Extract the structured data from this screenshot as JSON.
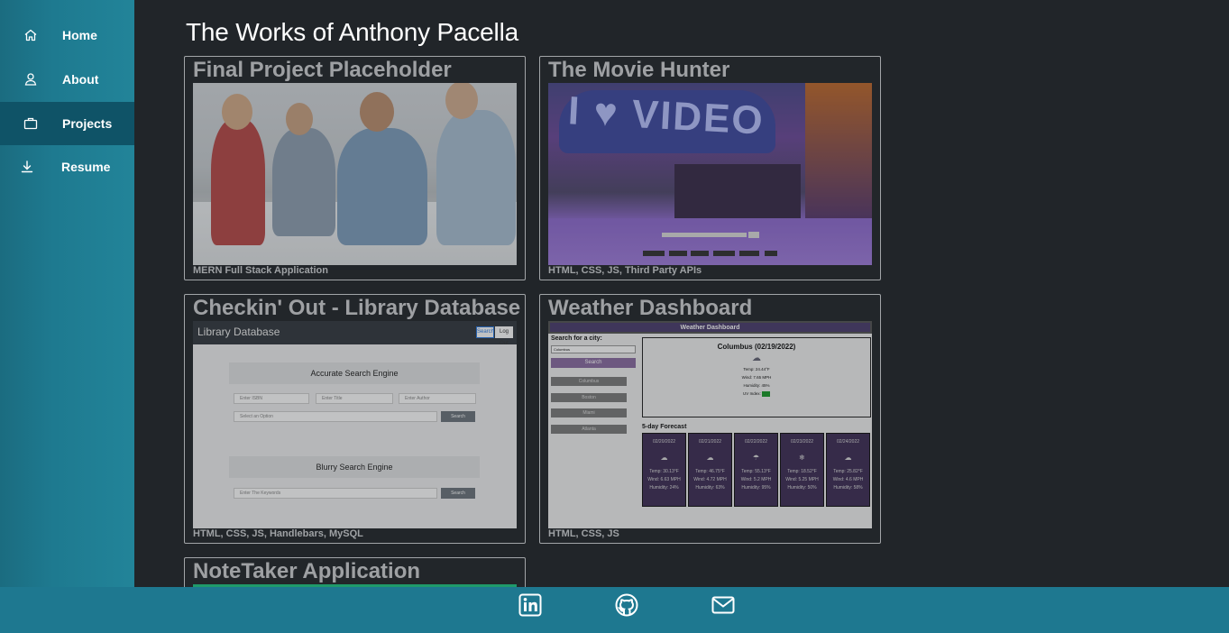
{
  "sidebar": {
    "items": [
      {
        "label": "Home",
        "icon": "home-icon"
      },
      {
        "label": "About",
        "icon": "user-icon"
      },
      {
        "label": "Projects",
        "icon": "briefcase-icon",
        "active": true
      },
      {
        "label": "Resume",
        "icon": "download-icon"
      }
    ]
  },
  "page": {
    "title": "The Works of Anthony Pacella"
  },
  "projects": [
    {
      "title": "Final Project Placeholder",
      "caption": "MERN Full Stack Application"
    },
    {
      "title": "The Movie Hunter",
      "caption": "HTML, CSS, JS, Third Party APIs"
    },
    {
      "title": "Checkin' Out - Library Database",
      "caption": "HTML, CSS, JS, Handlebars, MySQL"
    },
    {
      "title": "Weather Dashboard",
      "caption": "HTML, CSS, JS"
    },
    {
      "title": "NoteTaker Application",
      "caption": ""
    }
  ],
  "movie_shot": {
    "sign_text": "I ♥ VIDEO"
  },
  "library_shot": {
    "brand": "Library Database",
    "search_btn": "Search",
    "logout_btn": "Log Out",
    "accurate_title": "Accurate Search Engine",
    "isbn_placeholder": "Enter ISBN",
    "title_placeholder": "Enter Title",
    "author_placeholder": "Enter Author",
    "select_placeholder": "Select an Option",
    "search_label": "Search",
    "blurry_title": "Blurry Search Engine",
    "keyword_placeholder": "Enter The Keywords"
  },
  "weather_shot": {
    "header": "Weather Dashboard",
    "search_label": "Search for a city:",
    "input_value": "Columbus",
    "search_btn": "Search",
    "cities": [
      "Columbus",
      "Boston",
      "Miami",
      "Atlanta"
    ],
    "current_city": "Columbus (02/19/2022)",
    "temp": "Temp: 24.44°F",
    "wind": "Wind: 7.65 MPH",
    "humidity": "Humidity: 45%",
    "uv": "UV Index:",
    "forecast_label": "5-day Forecast",
    "days": [
      {
        "date": "02/20/2022",
        "temp": "Temp: 30.13°F",
        "wind": "Wind: 6.63 MPH",
        "hum": "Humidity: 24%"
      },
      {
        "date": "02/21/2022",
        "temp": "Temp: 46.75°F",
        "wind": "Wind: 4.72 MPH",
        "hum": "Humidity: 63%"
      },
      {
        "date": "02/22/2022",
        "temp": "Temp: 55.13°F",
        "wind": "Wind: 5.2 MPH",
        "hum": "Humidity: 95%"
      },
      {
        "date": "02/23/2022",
        "temp": "Temp: 18.52°F",
        "wind": "Wind: 5.25 MPH",
        "hum": "Humidity: 50%"
      },
      {
        "date": "02/24/2022",
        "temp": "Temp: 25.82°F",
        "wind": "Wind: 4.6 MPH",
        "hum": "Humidity: 58%"
      }
    ]
  },
  "footer": {
    "links": [
      "linkedin-icon",
      "github-icon",
      "mail-icon"
    ]
  },
  "colors": {
    "sidebar": "#1e7a90",
    "sidebar_active": "#0f5367",
    "background": "#212529",
    "footer": "#1e7890"
  }
}
